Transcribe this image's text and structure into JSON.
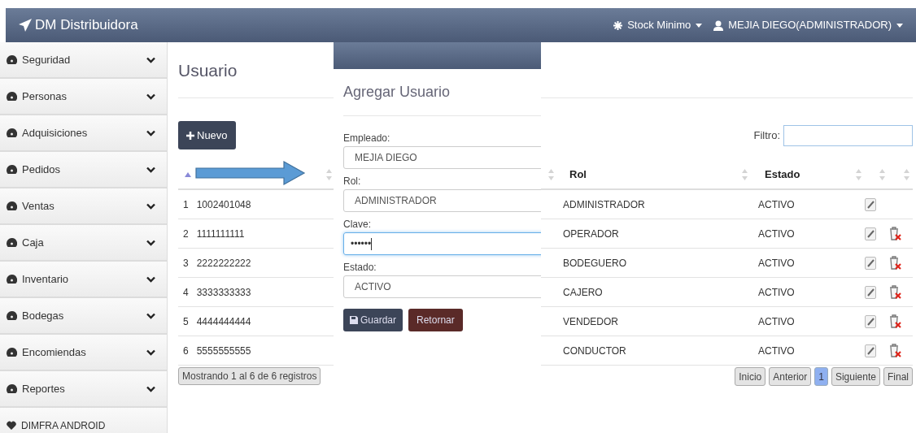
{
  "navbar": {
    "brand": "DM Distribuidora",
    "menus": [
      {
        "kind": "stock",
        "label": "Stock Minimo"
      },
      {
        "kind": "user",
        "label": "MEJIA DIEGO(ADMINISTRADOR)"
      }
    ]
  },
  "sidebar": {
    "items": [
      {
        "kind": "group",
        "label": "Seguridad"
      },
      {
        "kind": "group",
        "label": "Personas"
      },
      {
        "kind": "group",
        "label": "Adquisiciones"
      },
      {
        "kind": "group",
        "label": "Pedidos"
      },
      {
        "kind": "group",
        "label": "Ventas"
      },
      {
        "kind": "group",
        "label": "Caja"
      },
      {
        "kind": "group",
        "label": "Inventario"
      },
      {
        "kind": "group",
        "label": "Bodegas"
      },
      {
        "kind": "group",
        "label": "Encomiendas"
      },
      {
        "kind": "group",
        "label": "Reportes"
      },
      {
        "kind": "link",
        "label": "DIMFRA ANDROID"
      }
    ]
  },
  "page": {
    "title": "Usuario",
    "new_button": "Nuevo",
    "filter_label": "Filtro:"
  },
  "table": {
    "first_column_sorted_ascending": true,
    "columns": [
      "Rol",
      "Estado"
    ],
    "rows": [
      {
        "number": "1",
        "cedula": "1002401048",
        "rol": "ADMINISTRADOR",
        "estado": "ACTIVO",
        "deletable": false
      },
      {
        "number": "2",
        "cedula": "1111111111",
        "rol": "OPERADOR",
        "estado": "ACTIVO",
        "deletable": true
      },
      {
        "number": "3",
        "cedula": "2222222222",
        "rol": "BODEGUERO",
        "estado": "ACTIVO",
        "deletable": true
      },
      {
        "number": "4",
        "cedula": "3333333333",
        "rol": "CAJERO",
        "estado": "ACTIVO",
        "deletable": true
      },
      {
        "number": "5",
        "cedula": "4444444444",
        "rol": "VENDEDOR",
        "estado": "ACTIVO",
        "deletable": true
      },
      {
        "number": "6",
        "cedula": "5555555555",
        "rol": "CONDUCTOR",
        "estado": "ACTIVO",
        "deletable": true
      }
    ],
    "info": "Mostrando 1 al 6 de 6 registros",
    "pagination": [
      {
        "label": "Inicio",
        "selected": false
      },
      {
        "label": "Anterior",
        "selected": false
      },
      {
        "label": "1",
        "selected": true
      },
      {
        "label": "Siguiente",
        "selected": false
      },
      {
        "label": "Final",
        "selected": false
      }
    ]
  },
  "dialog": {
    "title": "Agregar Usuario",
    "fields": [
      {
        "label": "Empleado:",
        "value": "MEJIA DIEGO",
        "focused": false
      },
      {
        "label": "Rol:",
        "value": "ADMINISTRADOR",
        "focused": false
      },
      {
        "label": "Clave:",
        "value": "••••••",
        "focused": true
      },
      {
        "label": "Estado:",
        "value": "ACTIVO",
        "focused": false
      }
    ],
    "buttons": [
      {
        "kind": "save",
        "label": "Guardar"
      },
      {
        "kind": "back",
        "label": "Retornar"
      }
    ]
  }
}
